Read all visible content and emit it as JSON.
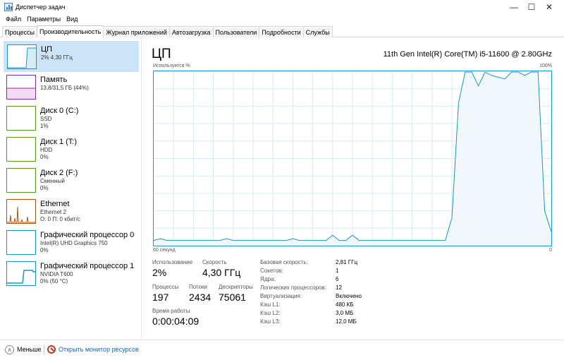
{
  "window": {
    "title": "Диспетчер задач",
    "minimize": "—",
    "maximize": "☐",
    "close": "✕"
  },
  "menu": [
    "Файл",
    "Параметры",
    "Вид"
  ],
  "tabs": [
    "Процессы",
    "Производительность",
    "Журнал приложений",
    "Автозагрузка",
    "Пользователи",
    "Подробности",
    "Службы"
  ],
  "active_tab": 1,
  "sidebar": {
    "items": [
      {
        "name": "ЦП",
        "lines": [
          "2% 4,30 ГГц"
        ],
        "color": "#1797c0"
      },
      {
        "name": "Память",
        "lines": [
          "13,8/31,5 ГБ (44%)"
        ],
        "color": "#8b2a9c"
      },
      {
        "name": "Диск 0 (C:)",
        "lines": [
          "SSD",
          "1%"
        ],
        "color": "#4ca319"
      },
      {
        "name": "Диск 1 (T:)",
        "lines": [
          "HDD",
          "0%"
        ],
        "color": "#4ca319"
      },
      {
        "name": "Диск 2 (F:)",
        "lines": [
          "Сменный",
          "0%"
        ],
        "color": "#4ca319"
      },
      {
        "name": "Ethernet",
        "lines": [
          "Ethernet 2",
          "О: 0 П: 0 кбит/с"
        ],
        "color": "#a7541b"
      },
      {
        "name": "Графический процессор 0",
        "lines": [
          "Intel(R) UHD Graphics 750",
          "0%"
        ],
        "color": "#1797c0"
      },
      {
        "name": "Графический процессор 1",
        "lines": [
          "NVIDIA T600",
          "0% (50 °C)"
        ],
        "color": "#1797c0"
      }
    ]
  },
  "main": {
    "title": "ЦП",
    "model": "11th Gen Intel(R) Core(TM) i5-11600 @ 2.80GHz",
    "graph_label": "Используется %",
    "graph_max": "100%",
    "graph_time": "60 секунд",
    "graph_min": "0"
  },
  "stats": {
    "usage_label": "Использование",
    "usage_value": "2%",
    "speed_label": "Скорость",
    "speed_value": "4,30 ГГц",
    "processes_label": "Процессы",
    "processes_value": "197",
    "threads_label": "Потоки",
    "threads_value": "2434",
    "handles_label": "Дескрипторы",
    "handles_value": "75061",
    "uptime_label": "Время работы",
    "uptime_value": "0:00:04:09"
  },
  "properties": [
    {
      "label": "Базовая скорость:",
      "value": "2,81 ГГц"
    },
    {
      "label": "Сокетов:",
      "value": "1"
    },
    {
      "label": "Ядра:",
      "value": "6"
    },
    {
      "label": "Логических процессоров:",
      "value": "12"
    },
    {
      "label": "Виртуализация:",
      "value": "Включено"
    },
    {
      "label": "Кэш L1:",
      "value": "480 КБ"
    },
    {
      "label": "Кэш L2:",
      "value": "3,0 МБ"
    },
    {
      "label": "Кэш L3:",
      "value": "12,0 МБ"
    }
  ],
  "footer": {
    "less": "Меньше",
    "monitor": "Открыть монитор ресурсов"
  },
  "chart_data": {
    "type": "area",
    "title": "Используется %",
    "x_label": "60 секунд",
    "ylim": [
      0,
      100
    ],
    "x": [
      0,
      1,
      2,
      3,
      4,
      5,
      6,
      7,
      8,
      9,
      10,
      11,
      12,
      13,
      14,
      15,
      16,
      17,
      18,
      19,
      20,
      21,
      22,
      23,
      24,
      25,
      26,
      27,
      28,
      29,
      30,
      31,
      32,
      33,
      34,
      35,
      36,
      37,
      38,
      39,
      40,
      41,
      42,
      43,
      44,
      45,
      46,
      47,
      48,
      49,
      50,
      51,
      52,
      53,
      54,
      55,
      56,
      57,
      58,
      59,
      60
    ],
    "values": [
      3,
      4,
      3,
      3,
      3,
      3,
      3,
      3,
      3,
      3,
      3,
      4,
      3,
      3,
      3,
      3,
      3,
      3,
      3,
      3,
      3,
      4,
      3,
      3,
      3,
      3,
      3,
      6,
      3,
      3,
      6,
      3,
      3,
      3,
      3,
      3,
      3,
      3,
      3,
      3,
      3,
      3,
      3,
      3,
      3,
      16,
      82,
      100,
      100,
      92,
      100,
      98,
      97,
      96,
      100,
      100,
      98,
      100,
      100,
      20,
      8
    ],
    "grid": true,
    "color": "#1797c0"
  }
}
